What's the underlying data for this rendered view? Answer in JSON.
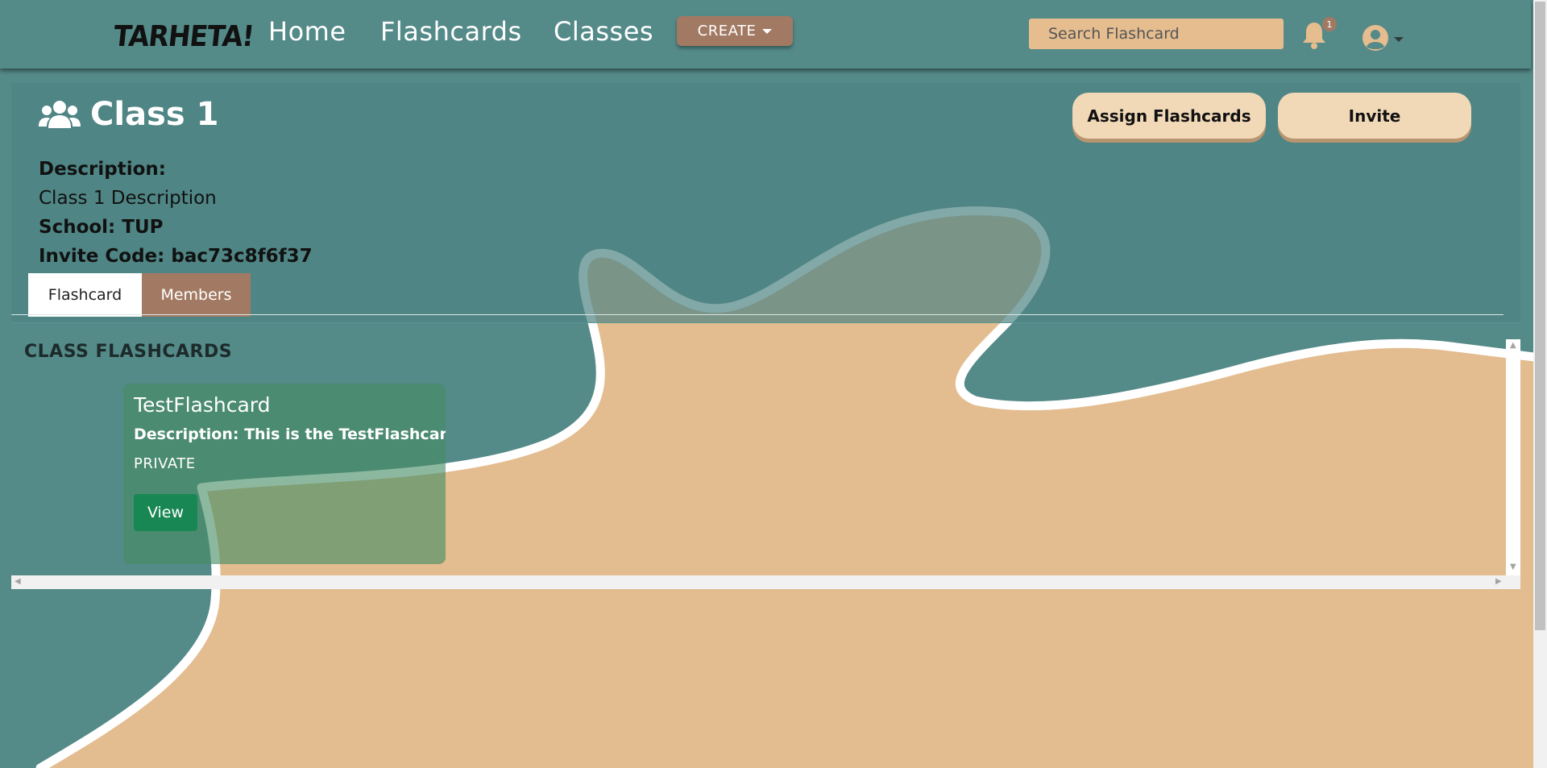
{
  "brand": {
    "name": "TARHETA!"
  },
  "nav": {
    "links": [
      "Home",
      "Flashcards",
      "Classes"
    ],
    "create_label": "CREATE",
    "search_placeholder": "Search Flashcard",
    "notification_count": "1"
  },
  "class": {
    "title": "Class 1",
    "description_label": "Description:",
    "description": "Class 1 Description",
    "school": "School: TUP",
    "invite_code": "Invite Code: bac73c8f6f37"
  },
  "actions": {
    "assign_label": "Assign Flashcards",
    "invite_label": "Invite"
  },
  "tabs": [
    {
      "label": "Flashcard",
      "active": true
    },
    {
      "label": "Members",
      "active": false
    }
  ],
  "section": {
    "heading": "CLASS FLASHCARDS"
  },
  "cards": [
    {
      "title": "TestFlashcard",
      "description": "Description: This is the TestFlashcard D",
      "visibility": "PRIVATE",
      "view_label": "View"
    }
  ],
  "colors": {
    "teal": "#548a88",
    "sand": "#e3bd90",
    "accent_brown": "#a27a63",
    "button_cream": "#f1d9b8",
    "view_green": "#198754"
  }
}
